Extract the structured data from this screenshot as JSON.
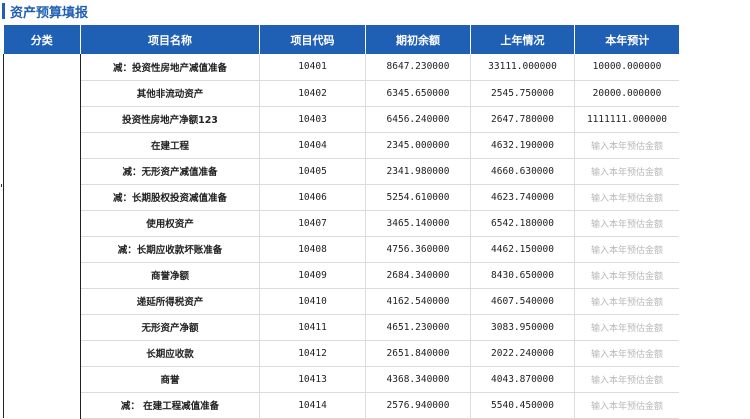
{
  "page": {
    "title": "资产预算填报"
  },
  "table": {
    "headers": [
      "分类",
      "项目名称",
      "项目代码",
      "期初余额",
      "上年情况",
      "本年预计"
    ],
    "placeholder": "输入本年预估金额",
    "rows": [
      {
        "name": "减：投资性房地产减值准备",
        "code": "10401",
        "opening": "8647.230000",
        "last_year": "33111.000000",
        "estimate": "10000.000000"
      },
      {
        "name": "其他非流动资产",
        "code": "10402",
        "opening": "6345.650000",
        "last_year": "2545.750000",
        "estimate": "20000.000000"
      },
      {
        "name": "投资性房地产净额123",
        "code": "10403",
        "opening": "6456.240000",
        "last_year": "2647.780000",
        "estimate": "1111111.000000"
      },
      {
        "name": "在建工程",
        "code": "10404",
        "opening": "2345.000000",
        "last_year": "4632.190000",
        "estimate": ""
      },
      {
        "name": "减：无形资产减值准备",
        "code": "10405",
        "opening": "2341.980000",
        "last_year": "4660.630000",
        "estimate": ""
      },
      {
        "name": "减：长期股权投资减值准备",
        "code": "10406",
        "opening": "5254.610000",
        "last_year": "4623.740000",
        "estimate": ""
      },
      {
        "name": "使用权资产",
        "code": "10407",
        "opening": "3465.140000",
        "last_year": "6542.180000",
        "estimate": ""
      },
      {
        "name": "减：长期应收款坏账准备",
        "code": "10408",
        "opening": "4756.360000",
        "last_year": "4462.150000",
        "estimate": ""
      },
      {
        "name": "商誉净额",
        "code": "10409",
        "opening": "2684.340000",
        "last_year": "8430.650000",
        "estimate": ""
      },
      {
        "name": "递延所得税资产",
        "code": "10410",
        "opening": "4162.540000",
        "last_year": "4607.540000",
        "estimate": ""
      },
      {
        "name": "无形资产净额",
        "code": "10411",
        "opening": "4651.230000",
        "last_year": "3083.950000",
        "estimate": ""
      },
      {
        "name": "长期应收款",
        "code": "10412",
        "opening": "2651.840000",
        "last_year": "2022.240000",
        "estimate": ""
      },
      {
        "name": "商誉",
        "code": "10413",
        "opening": "4368.340000",
        "last_year": "4043.870000",
        "estimate": ""
      },
      {
        "name": "减：  在建工程减值准备",
        "code": "10414",
        "opening": "2576.940000",
        "last_year": "5540.450000",
        "estimate": ""
      }
    ]
  }
}
